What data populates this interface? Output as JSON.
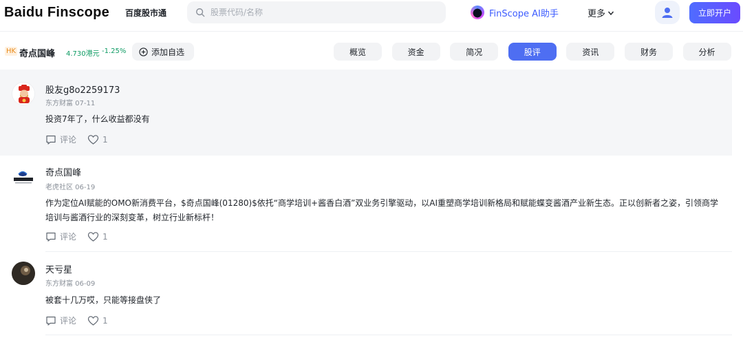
{
  "header": {
    "logo": "Baidu Finscope",
    "subtitle": "百度股市通",
    "search_placeholder": "股票代码/名称",
    "ai_label": "FinScope AI助手",
    "more_label": "更多",
    "open_account": "立即开户"
  },
  "stock": {
    "market": "HK",
    "name": "奇点国峰",
    "price": "4.730港元",
    "change": "-1.25%",
    "add_watchlist": "添加自选",
    "tabs": [
      {
        "label": "概览",
        "active": false
      },
      {
        "label": "资金",
        "active": false
      },
      {
        "label": "简况",
        "active": false
      },
      {
        "label": "股评",
        "active": true
      },
      {
        "label": "资讯",
        "active": false
      },
      {
        "label": "财务",
        "active": false
      },
      {
        "label": "分析",
        "active": false
      }
    ]
  },
  "posts": [
    {
      "user": "股友g8o2259173",
      "source_date": "东方财富 07-11",
      "content": "投资7年了，什么收益都没有",
      "comment_label": "评论",
      "likes": "1"
    },
    {
      "user": "奇点国峰",
      "source_date": "老虎社区 06-19",
      "content": "作为定位AI赋能的OMO新消费平台，$奇点国峰(01280)$依托“商学培训+酱香白酒”双业务引擎驱动，以AI重塑商学培训新格局和赋能蝶变酱酒产业新生态。正以创新者之姿，引领商学培训与酱酒行业的深刻变革，树立行业新标杆！",
      "comment_label": "评论",
      "likes": "1"
    },
    {
      "user": "天亏星",
      "source_date": "东方财富 06-09",
      "content": "被套十几万哎，只能等接盘侠了",
      "comment_label": "评论",
      "likes": "1"
    }
  ],
  "colors": {
    "accent": "#4e6ef2",
    "down": "#0d9b63",
    "highlight_bg": "#f5f6f8"
  }
}
